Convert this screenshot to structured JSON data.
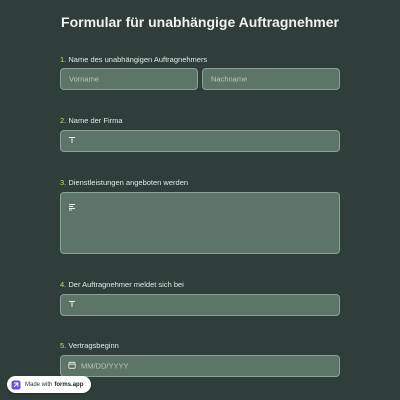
{
  "form": {
    "title": "Formular für unabhängige Auftragnehmer",
    "questions": [
      {
        "number": "1.",
        "label": "Name des unabhängigen Auftragnehmers",
        "first_placeholder": "Vorname",
        "last_placeholder": "Nachname"
      },
      {
        "number": "2.",
        "label": "Name der Firma",
        "icon": "text-icon"
      },
      {
        "number": "3.",
        "label": "Dienstleistungen angeboten werden",
        "icon": "paragraph-icon"
      },
      {
        "number": "4.",
        "label": "Der Auftragnehmer meldet sich bei",
        "icon": "text-icon"
      },
      {
        "number": "5.",
        "label": "Vertragsbeginn",
        "placeholder": "MM/DD/YYYY",
        "icon": "calendar-icon"
      }
    ]
  },
  "badge": {
    "prefix": "Made with",
    "brand": "forms.app",
    "icon": "forms-app-logo"
  },
  "colors": {
    "background": "#2f3d3b",
    "field": "#5d7469",
    "field_border": "#8aa298",
    "number_accent": "#c9dc74"
  }
}
